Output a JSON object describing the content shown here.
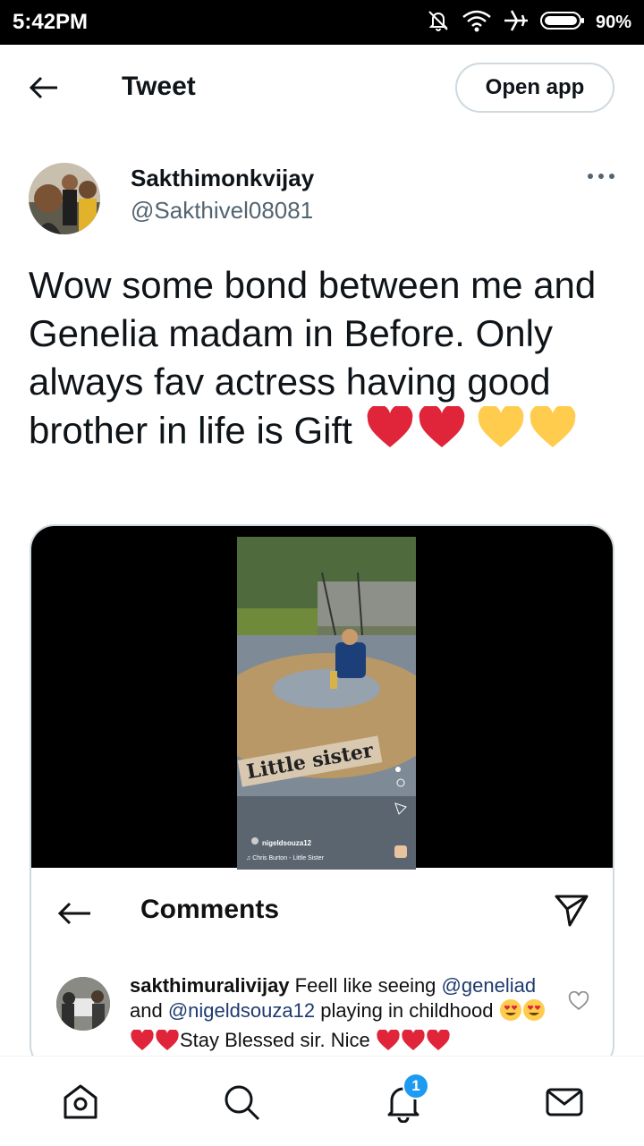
{
  "status_bar": {
    "time": "5:42PM",
    "battery": "90%",
    "icons": [
      "muted-bell-icon",
      "wifi-icon",
      "airplane-icon",
      "battery-icon"
    ]
  },
  "header": {
    "title": "Tweet",
    "open_app_label": "Open app"
  },
  "tweet": {
    "author_name": "Sakthimonkvijay",
    "author_handle": "@Sakthivel08081",
    "text": "Wow some bond between me and Genelia madam in Before. Only always fav actress having good brother in life is Gift",
    "trailing_emoji": [
      "red-heart",
      "red-heart",
      "yellow-heart",
      "yellow-heart"
    ]
  },
  "media": {
    "story_caption": "Little sister",
    "story_username": "nigeldsouza12",
    "story_song": "♫ Chris Burton - Little Sister",
    "comments_title": "Comments",
    "comment": {
      "user": "sakthimuralivijay",
      "text_1": "Feell like seeing",
      "mention_1": "@geneliad",
      "text_2": "and",
      "mention_2": "@nigeldsouza12",
      "text_3": "playing in childhood",
      "text_4": "Stay Blessed sir. Nice"
    }
  },
  "bottom_nav": {
    "items": [
      "home-icon",
      "search-icon",
      "notifications-icon",
      "messages-icon"
    ],
    "notification_count": "1"
  },
  "colors": {
    "accent": "#1d9bf0",
    "text": "#0f1419",
    "secondary_text": "#536471",
    "border": "#cfd9de",
    "heart_red": "#e0253b",
    "heart_yellow": "#ffcc4d"
  }
}
